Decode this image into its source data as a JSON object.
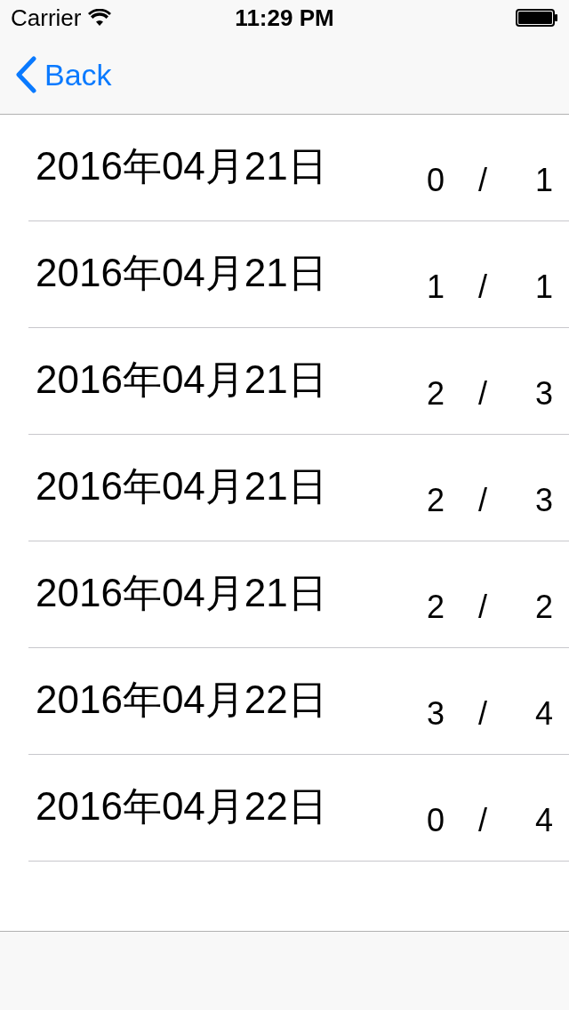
{
  "status_bar": {
    "carrier": "Carrier",
    "time": "11:29 PM"
  },
  "nav_bar": {
    "back": "Back"
  },
  "rows": [
    {
      "date": "2016年04月21日",
      "count": "0",
      "separator": "/",
      "total": "1"
    },
    {
      "date": "2016年04月21日",
      "count": "1",
      "separator": "/",
      "total": "1"
    },
    {
      "date": "2016年04月21日",
      "count": "2",
      "separator": "/",
      "total": "3"
    },
    {
      "date": "2016年04月21日",
      "count": "2",
      "separator": "/",
      "total": "3"
    },
    {
      "date": "2016年04月21日",
      "count": "2",
      "separator": "/",
      "total": "2"
    },
    {
      "date": "2016年04月22日",
      "count": "3",
      "separator": "/",
      "total": "4"
    },
    {
      "date": "2016年04月22日",
      "count": "0",
      "separator": "/",
      "total": "4"
    }
  ]
}
